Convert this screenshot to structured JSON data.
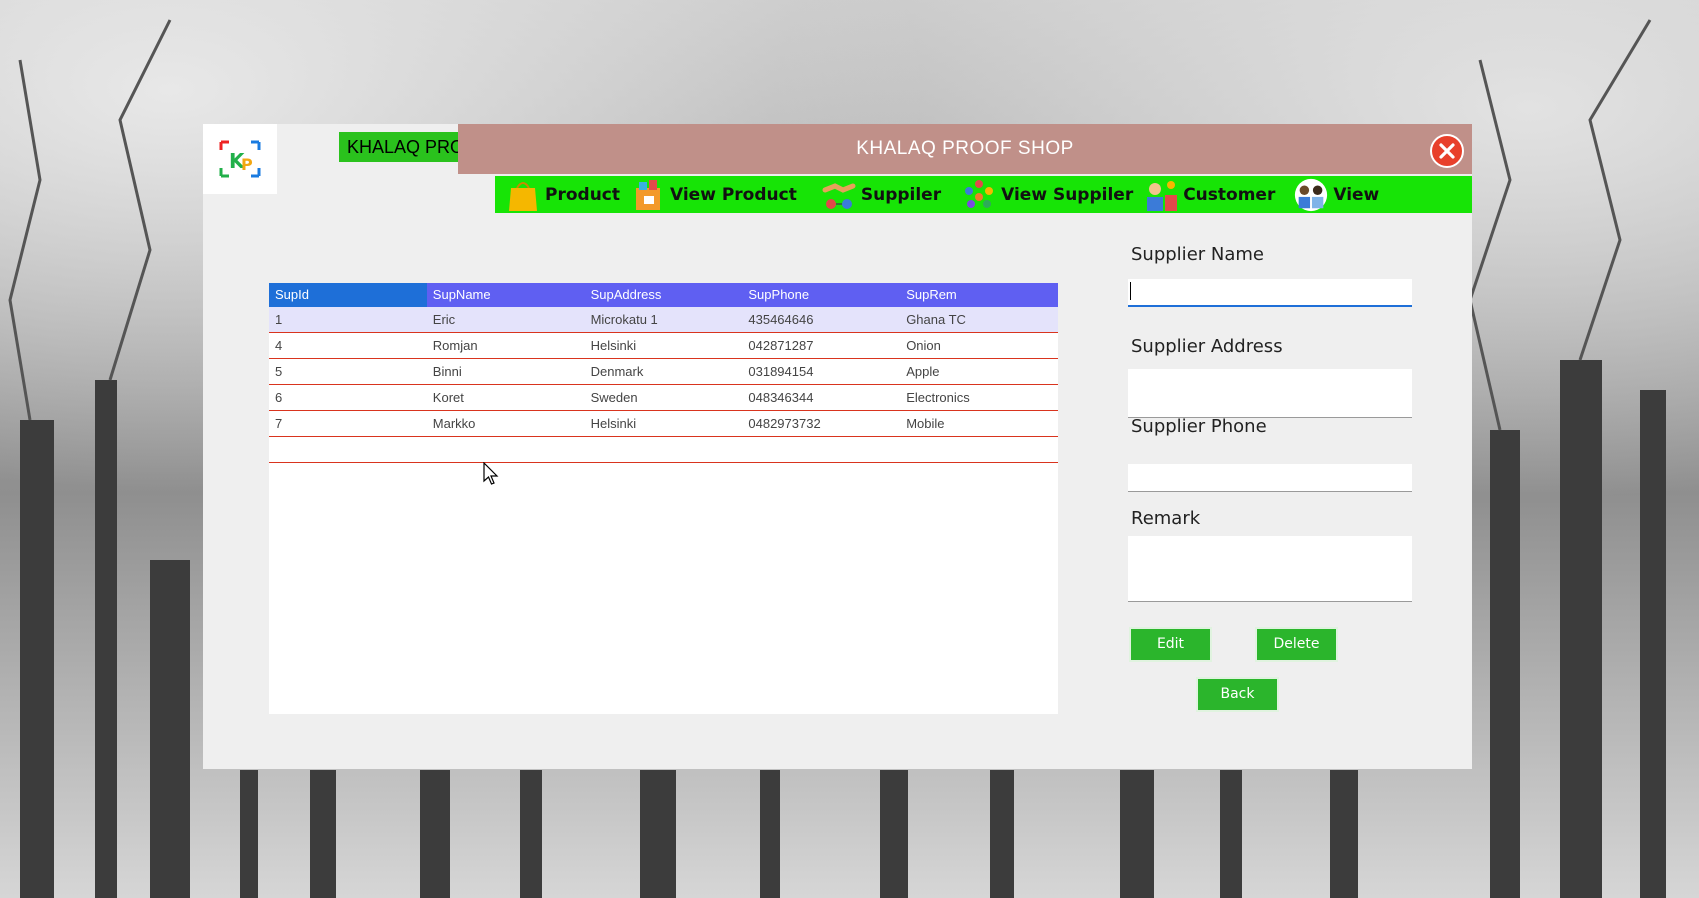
{
  "app": {
    "brand": "KHALAQ PROOF",
    "title": "KHALAQ PROOF SHOP",
    "logo_text": "KP"
  },
  "nav": [
    {
      "label": "Product",
      "icon": "shopping-bag-icon"
    },
    {
      "label": "View Product",
      "icon": "product-box-icon"
    },
    {
      "label": "Suppiler",
      "icon": "handshake-icon"
    },
    {
      "label": "View Suppiler",
      "icon": "people-group-icon"
    },
    {
      "label": "Customer",
      "icon": "customer-icon"
    },
    {
      "label": "View",
      "icon": "users-icon"
    }
  ],
  "table": {
    "columns": [
      "SupId",
      "SupName",
      "SupAddress",
      "SupPhone",
      "SupRem"
    ],
    "rows": [
      [
        "1",
        "Eric",
        "Microkatu 1",
        "435464646",
        "Ghana TC"
      ],
      [
        "4",
        "Romjan",
        "Helsinki",
        "042871287",
        "Onion"
      ],
      [
        "5",
        "Binni",
        "Denmark",
        "031894154",
        "Apple"
      ],
      [
        "6",
        "Koret",
        "Sweden",
        "048346344",
        "Electronics"
      ],
      [
        "7",
        "Markko",
        "Helsinki",
        "0482973732",
        "Mobile"
      ],
      [
        "",
        "",
        "",
        "",
        ""
      ]
    ]
  },
  "form": {
    "name_label": "Supplier Name",
    "name_value": "",
    "address_label": "Supplier Address",
    "address_value": "",
    "phone_label": "Supplier Phone",
    "phone_value": "",
    "remark_label": "Remark",
    "remark_value": ""
  },
  "buttons": {
    "edit": "Edit",
    "delete": "Delete",
    "back": "Back"
  },
  "colors": {
    "titlebar": "#c09089",
    "navbar": "#17e406",
    "brand_bg": "#2ac21d",
    "grid_header": "#5f5ff2",
    "grid_header_first": "#1e6fd8",
    "row_border": "#d9341e",
    "button": "#2bb52c",
    "close": "#e8402b"
  }
}
